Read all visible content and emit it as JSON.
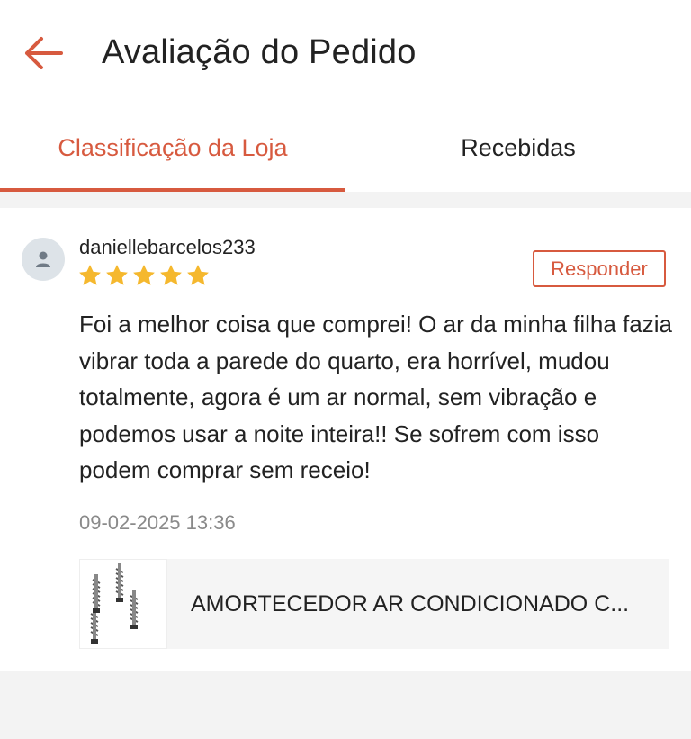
{
  "header": {
    "title": "Avaliação do Pedido",
    "back_icon": "arrow-left-icon",
    "accent_color": "#d75a3f"
  },
  "tabs": [
    {
      "label": "Classificação da Loja",
      "active": true
    },
    {
      "label": "Recebidas",
      "active": false
    }
  ],
  "review": {
    "username": "daniellebarcelos233",
    "rating": 5,
    "rating_max": 5,
    "star_color": "#f5b82e",
    "reply_label": "Responder",
    "comment": "Foi a melhor coisa que comprei! O ar da minha filha fazia vibrar toda a parede do quarto, era horrível, mudou totalmente, agora é um ar normal, sem vibração e podemos usar a noite inteira!! Se sofrem com isso podem comprar sem receio!",
    "timestamp": "09-02-2025 13:36",
    "product": {
      "name": "AMORTECEDOR AR CONDICIONADO C...",
      "thumbnail_icon": "shock-absorber-springs-image"
    }
  }
}
